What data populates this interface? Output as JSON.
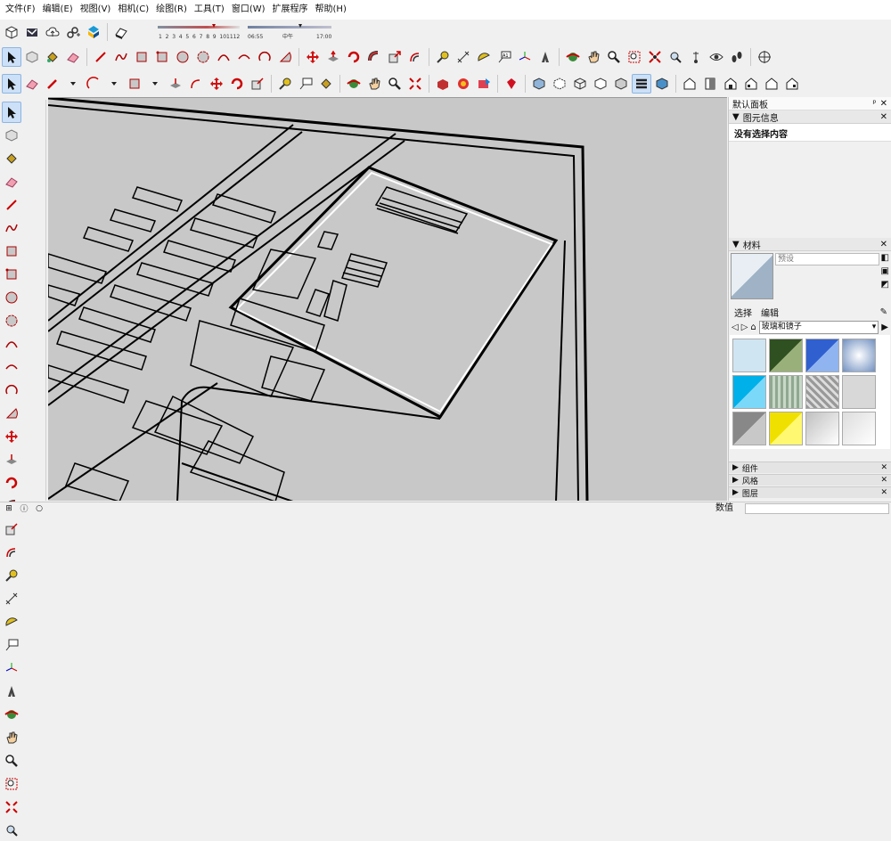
{
  "menu": [
    "文件(F)",
    "编辑(E)",
    "视图(V)",
    "相机(C)",
    "绘图(R)",
    "工具(T)",
    "窗口(W)",
    "扩展程序",
    "帮助(H)"
  ],
  "shadow": {
    "months": [
      "1",
      "2",
      "3",
      "4",
      "5",
      "6",
      "7",
      "8",
      "9",
      "10",
      "11",
      "12"
    ],
    "time_start": "06:55",
    "time_mid": "中午",
    "time_end": "17:00"
  },
  "panel": {
    "title": "默认面板",
    "entity_info": {
      "label": "图元信息",
      "content": "没有选择内容"
    },
    "materials": {
      "label": "材料",
      "current_name": "预设",
      "tab_select": "选择",
      "tab_edit": "编辑",
      "library": "玻璃和镜子"
    },
    "components_label": "组件",
    "styles_label": "风格",
    "layers_label": "图层"
  },
  "status": {
    "value_label": "数值"
  },
  "colors": {
    "viewport": "#c8c8c8",
    "accent": "#cce0f7"
  },
  "swatches": [
    "#cfe5f2",
    "#5c7d2c",
    "#7aa0e0",
    "#b4cbe6",
    "#2fb7ea",
    "#b8c8b4",
    "#d4d4d4",
    "#e0e0e0",
    "#9a9a9a",
    "#ffee22",
    "#bcbcbc",
    "#e8e8e8"
  ]
}
